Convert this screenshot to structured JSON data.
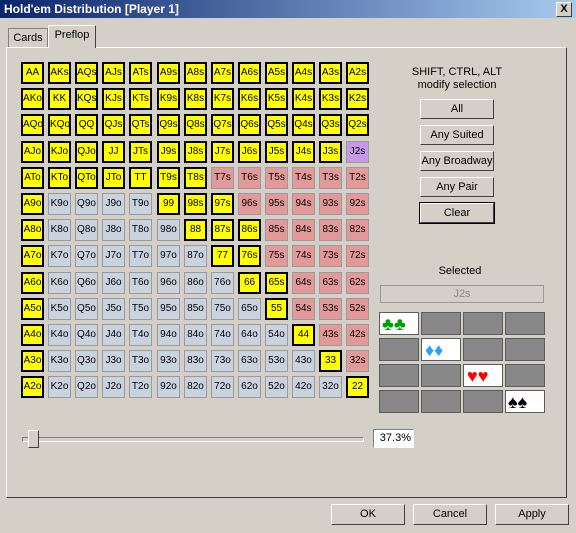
{
  "window": {
    "title": "Hold'em Distribution [Player 1]",
    "close": "X"
  },
  "tabs": [
    {
      "label": "Cards"
    },
    {
      "label": "Preflop"
    }
  ],
  "hint": {
    "line1": "SHIFT, CTRL, ALT",
    "line2": "modify selection"
  },
  "buttons": [
    "All",
    "Any Suited",
    "Any Broadway",
    "Any Pair",
    "Clear"
  ],
  "selected_label": "Selected",
  "selected_value": "J2s",
  "percent": "37.3%",
  "bottom_buttons": {
    "ok": "OK",
    "cancel": "Cancel",
    "apply": "Apply"
  },
  "suits": [
    "♣♣",
    "♦♦",
    "♥♥",
    "♠♠"
  ],
  "suit_colors": [
    "#00a000",
    "#2aa0ff",
    "#ff0000",
    "#000000"
  ],
  "grid": [
    [
      "AA",
      "AKs",
      "AQs",
      "AJs",
      "ATs",
      "A9s",
      "A8s",
      "A7s",
      "A6s",
      "A5s",
      "A4s",
      "A3s",
      "A2s"
    ],
    [
      "AKo",
      "KK",
      "KQs",
      "KJs",
      "KTs",
      "K9s",
      "K8s",
      "K7s",
      "K6s",
      "K5s",
      "K4s",
      "K3s",
      "K2s"
    ],
    [
      "AQo",
      "KQo",
      "QQ",
      "QJs",
      "QTs",
      "Q9s",
      "Q8s",
      "Q7s",
      "Q6s",
      "Q5s",
      "Q4s",
      "Q3s",
      "Q2s"
    ],
    [
      "AJo",
      "KJo",
      "QJo",
      "JJ",
      "JTs",
      "J9s",
      "J8s",
      "J7s",
      "J6s",
      "J5s",
      "J4s",
      "J3s",
      "J2s"
    ],
    [
      "ATo",
      "KTo",
      "QTo",
      "JTo",
      "TT",
      "T9s",
      "T8s",
      "T7s",
      "T6s",
      "T5s",
      "T4s",
      "T3s",
      "T2s"
    ],
    [
      "A9o",
      "K9o",
      "Q9o",
      "J9o",
      "T9o",
      "99",
      "98s",
      "97s",
      "96s",
      "95s",
      "94s",
      "93s",
      "92s"
    ],
    [
      "A8o",
      "K8o",
      "Q8o",
      "J8o",
      "T8o",
      "98o",
      "88",
      "87s",
      "86s",
      "85s",
      "84s",
      "83s",
      "82s"
    ],
    [
      "A7o",
      "K7o",
      "Q7o",
      "J7o",
      "T7o",
      "97o",
      "87o",
      "77",
      "76s",
      "75s",
      "74s",
      "73s",
      "72s"
    ],
    [
      "A6o",
      "K6o",
      "Q6o",
      "J6o",
      "T6o",
      "96o",
      "86o",
      "76o",
      "66",
      "65s",
      "64s",
      "63s",
      "62s"
    ],
    [
      "A5o",
      "K5o",
      "Q5o",
      "J5o",
      "T5o",
      "95o",
      "85o",
      "75o",
      "65o",
      "55",
      "54s",
      "53s",
      "52s"
    ],
    [
      "A4o",
      "K4o",
      "Q4o",
      "J4o",
      "T4o",
      "94o",
      "84o",
      "74o",
      "64o",
      "54o",
      "44",
      "43s",
      "42s"
    ],
    [
      "A3o",
      "K3o",
      "Q3o",
      "J3o",
      "T3o",
      "93o",
      "83o",
      "73o",
      "63o",
      "53o",
      "43o",
      "33",
      "32s"
    ],
    [
      "A2o",
      "K2o",
      "Q2o",
      "J2o",
      "T2o",
      "92o",
      "82o",
      "72o",
      "62o",
      "52o",
      "42o",
      "32o",
      "22"
    ]
  ],
  "selected_hands": [
    "AA",
    "AKs",
    "AQs",
    "AJs",
    "ATs",
    "A9s",
    "A8s",
    "A7s",
    "A6s",
    "A5s",
    "A4s",
    "A3s",
    "A2s",
    "AKo",
    "KK",
    "KQs",
    "KJs",
    "KTs",
    "K9s",
    "K8s",
    "K7s",
    "K6s",
    "K5s",
    "K4s",
    "K3s",
    "K2s",
    "AQo",
    "KQo",
    "QQ",
    "QJs",
    "QTs",
    "Q9s",
    "Q8s",
    "Q7s",
    "Q6s",
    "Q5s",
    "Q4s",
    "Q3s",
    "Q2s",
    "AJo",
    "KJo",
    "QJo",
    "JJ",
    "JTs",
    "J9s",
    "J8s",
    "J7s",
    "J6s",
    "J5s",
    "J4s",
    "J3s",
    "ATo",
    "KTo",
    "QTo",
    "JTo",
    "TT",
    "T9s",
    "T8s",
    "A9o",
    "99",
    "98s",
    "97s",
    "A8o",
    "88",
    "87s",
    "86s",
    "A7o",
    "77",
    "76s",
    "A6o",
    "66",
    "65s",
    "A5o",
    "55",
    "A4o",
    "44",
    "A3o",
    "33",
    "A2o",
    "22"
  ],
  "current_hand": "J2s"
}
